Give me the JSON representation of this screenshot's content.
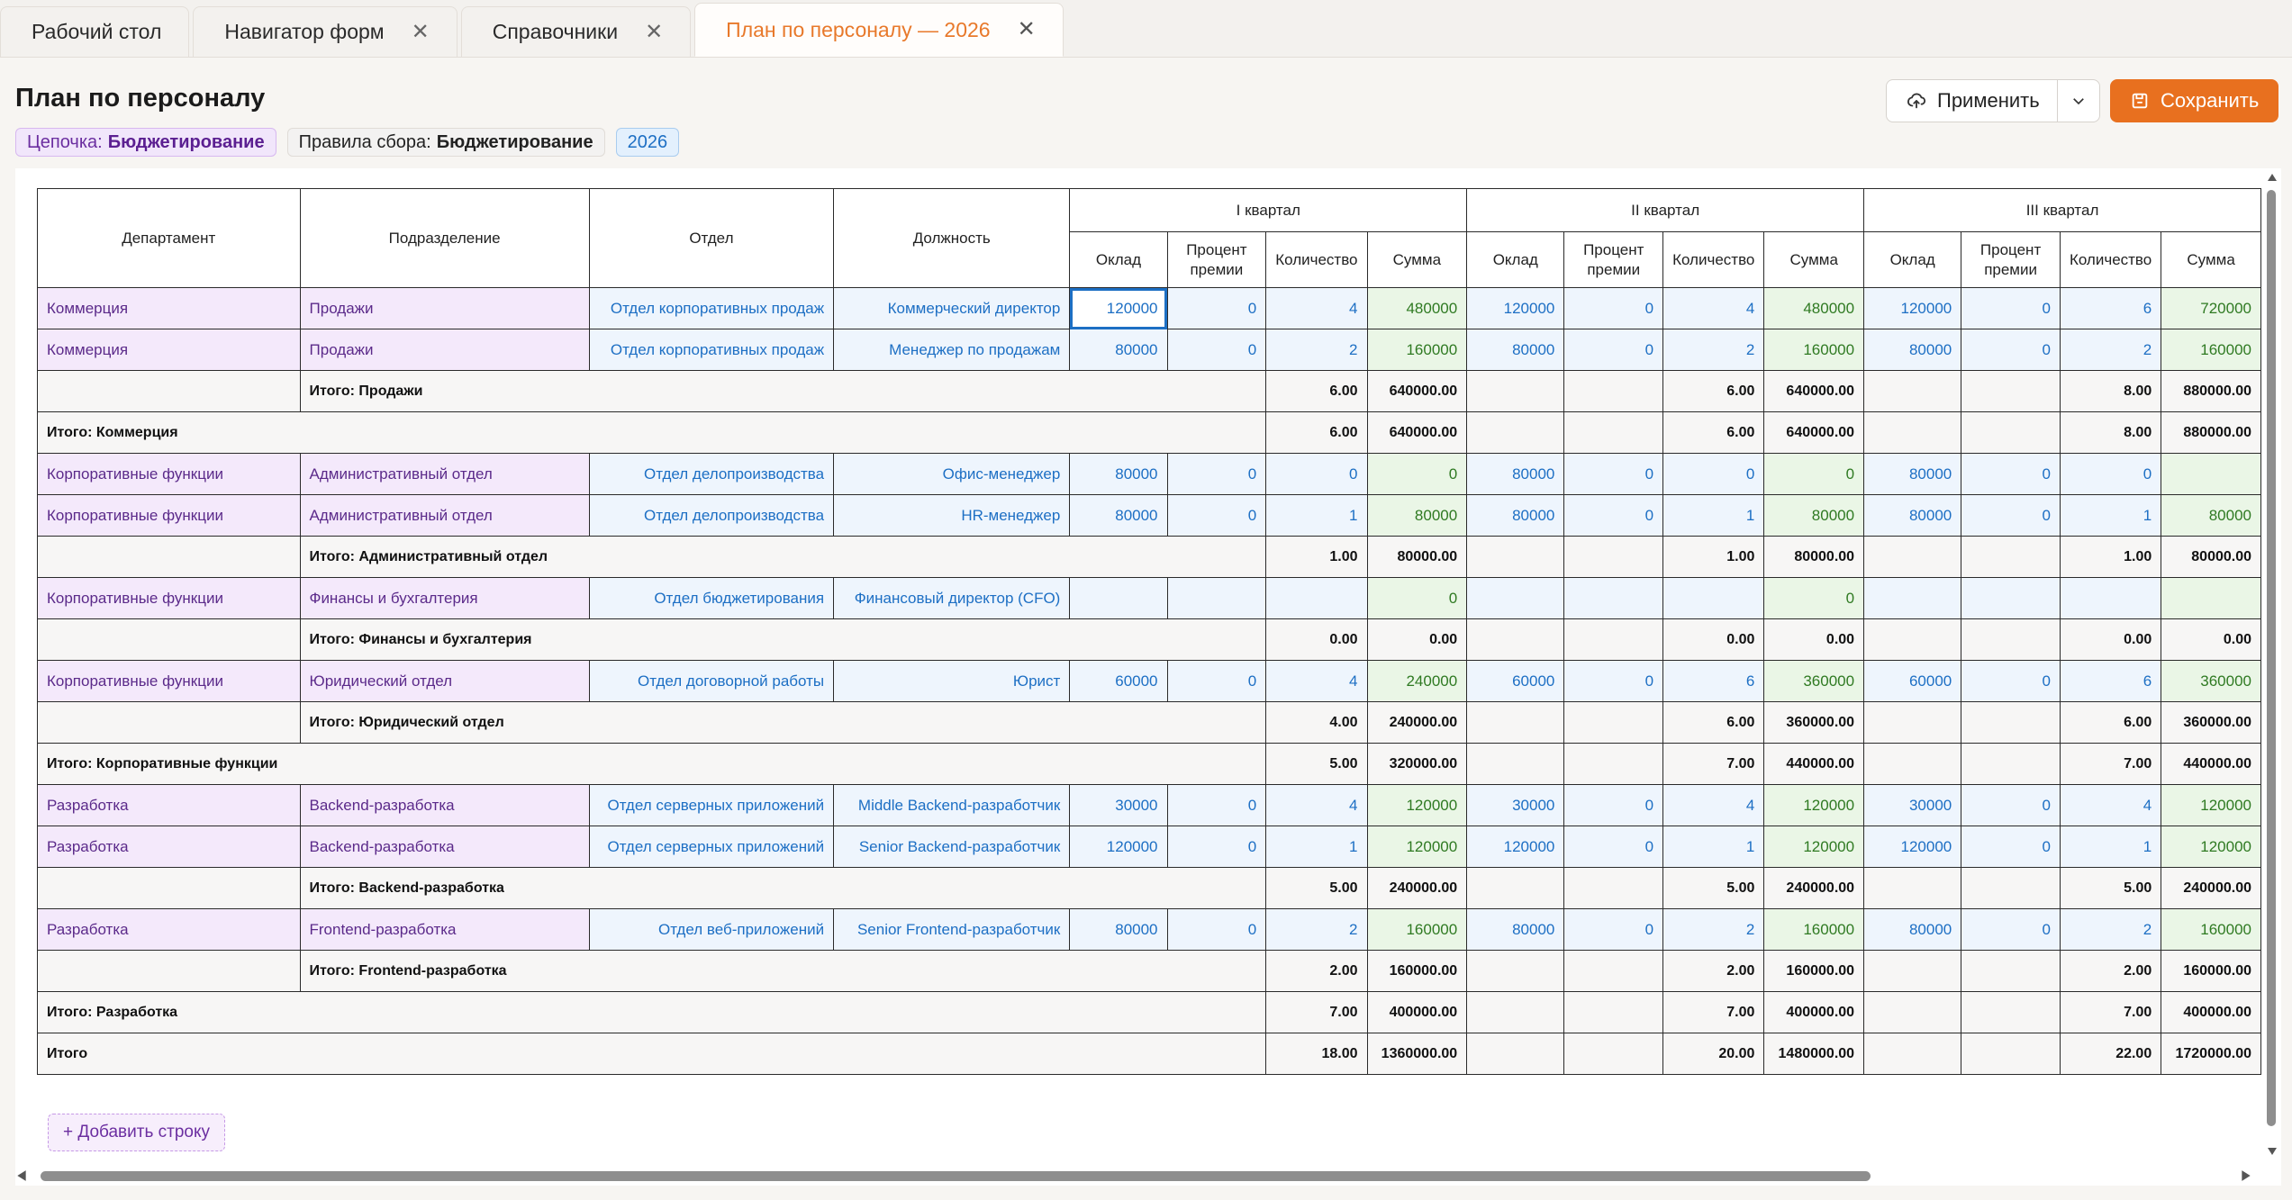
{
  "tabs": [
    {
      "label": "Рабочий стол",
      "closable": false,
      "active": false
    },
    {
      "label": "Навигатор форм",
      "closable": true,
      "active": false
    },
    {
      "label": "Справочники",
      "closable": true,
      "active": false
    },
    {
      "label": "План по персоналу — 2026",
      "closable": true,
      "active": true
    }
  ],
  "header": {
    "title": "План по персоналу",
    "chain_label": "Цепочка:",
    "chain_value": "Бюджетирование",
    "rules_label": "Правила сбора:",
    "rules_value": "Бюджетирование",
    "year": "2026"
  },
  "toolbar": {
    "apply_label": "Применить",
    "save_label": "Сохранить"
  },
  "grid": {
    "columns_fixed": [
      "Департамент",
      "Подразделение",
      "Отдел",
      "Должность"
    ],
    "quarters": [
      "I квартал",
      "II квартал",
      "III квартал"
    ],
    "quarter_columns": [
      "Оклад",
      "Процент премии",
      "Количество",
      "Сумма"
    ],
    "rows": [
      {
        "type": "data",
        "dept": "Коммерция",
        "sub": "Продажи",
        "otd": "Отдел корпоративных продаж",
        "pos": "Коммерческий директор",
        "q": [
          [
            "120000",
            "0",
            "4",
            "480000"
          ],
          [
            "120000",
            "0",
            "4",
            "480000"
          ],
          [
            "120000",
            "0",
            "6",
            "720000"
          ]
        ],
        "selected": true
      },
      {
        "type": "data",
        "dept": "Коммерция",
        "sub": "Продажи",
        "otd": "Отдел корпоративных продаж",
        "pos": "Менеджер по продажам",
        "q": [
          [
            "80000",
            "0",
            "2",
            "160000"
          ],
          [
            "80000",
            "0",
            "2",
            "160000"
          ],
          [
            "80000",
            "0",
            "2",
            "160000"
          ]
        ]
      },
      {
        "type": "subtotal",
        "label": "Итого: Продажи",
        "q": [
          [
            "6.00",
            "640000.00"
          ],
          [
            "6.00",
            "640000.00"
          ],
          [
            "8.00",
            "880000.00"
          ]
        ]
      },
      {
        "type": "total",
        "label": "Итого: Коммерция",
        "q": [
          [
            "6.00",
            "640000.00"
          ],
          [
            "6.00",
            "640000.00"
          ],
          [
            "8.00",
            "880000.00"
          ]
        ]
      },
      {
        "type": "data",
        "dept": "Корпоративные функции",
        "sub": "Административный отдел",
        "otd": "Отдел делопроизводства",
        "pos": "Офис-менеджер",
        "q": [
          [
            "80000",
            "0",
            "0",
            "0"
          ],
          [
            "80000",
            "0",
            "0",
            "0"
          ],
          [
            "80000",
            "0",
            "0",
            ""
          ]
        ]
      },
      {
        "type": "data",
        "dept": "Корпоративные функции",
        "sub": "Административный отдел",
        "otd": "Отдел делопроизводства",
        "pos": "HR-менеджер",
        "q": [
          [
            "80000",
            "0",
            "1",
            "80000"
          ],
          [
            "80000",
            "0",
            "1",
            "80000"
          ],
          [
            "80000",
            "0",
            "1",
            "80000"
          ]
        ]
      },
      {
        "type": "subtotal",
        "label": "Итого: Административный отдел",
        "q": [
          [
            "1.00",
            "80000.00"
          ],
          [
            "1.00",
            "80000.00"
          ],
          [
            "1.00",
            "80000.00"
          ]
        ]
      },
      {
        "type": "data",
        "dept": "Корпоративные функции",
        "sub": "Финансы и бухгалтерия",
        "otd": "Отдел бюджетирования",
        "pos": "Финансовый директор (CFO)",
        "q": [
          [
            "",
            "",
            "",
            "0"
          ],
          [
            "",
            "",
            "",
            "0"
          ],
          [
            "",
            "",
            "",
            ""
          ]
        ]
      },
      {
        "type": "subtotal",
        "label": "Итого: Финансы и бухгалтерия",
        "q": [
          [
            "0.00",
            "0.00"
          ],
          [
            "0.00",
            "0.00"
          ],
          [
            "0.00",
            "0.00"
          ]
        ]
      },
      {
        "type": "data",
        "dept": "Корпоративные функции",
        "sub": "Юридический отдел",
        "otd": "Отдел договорной работы",
        "pos": "Юрист",
        "q": [
          [
            "60000",
            "0",
            "4",
            "240000"
          ],
          [
            "60000",
            "0",
            "6",
            "360000"
          ],
          [
            "60000",
            "0",
            "6",
            "360000"
          ]
        ]
      },
      {
        "type": "subtotal",
        "label": "Итого: Юридический отдел",
        "q": [
          [
            "4.00",
            "240000.00"
          ],
          [
            "6.00",
            "360000.00"
          ],
          [
            "6.00",
            "360000.00"
          ]
        ]
      },
      {
        "type": "total",
        "label": "Итого: Корпоративные функции",
        "q": [
          [
            "5.00",
            "320000.00"
          ],
          [
            "7.00",
            "440000.00"
          ],
          [
            "7.00",
            "440000.00"
          ]
        ]
      },
      {
        "type": "data",
        "dept": "Разработка",
        "sub": "Backend-разработка",
        "otd": "Отдел серверных приложений",
        "pos": "Middle Backend-разработчик",
        "q": [
          [
            "30000",
            "0",
            "4",
            "120000"
          ],
          [
            "30000",
            "0",
            "4",
            "120000"
          ],
          [
            "30000",
            "0",
            "4",
            "120000"
          ]
        ]
      },
      {
        "type": "data",
        "dept": "Разработка",
        "sub": "Backend-разработка",
        "otd": "Отдел серверных приложений",
        "pos": "Senior Backend-разработчик",
        "q": [
          [
            "120000",
            "0",
            "1",
            "120000"
          ],
          [
            "120000",
            "0",
            "1",
            "120000"
          ],
          [
            "120000",
            "0",
            "1",
            "120000"
          ]
        ]
      },
      {
        "type": "subtotal",
        "label": "Итого: Backend-разработка",
        "q": [
          [
            "5.00",
            "240000.00"
          ],
          [
            "5.00",
            "240000.00"
          ],
          [
            "5.00",
            "240000.00"
          ]
        ]
      },
      {
        "type": "data",
        "dept": "Разработка",
        "sub": "Frontend-разработка",
        "otd": "Отдел веб-приложений",
        "pos": "Senior Frontend-разработчик",
        "q": [
          [
            "80000",
            "0",
            "2",
            "160000"
          ],
          [
            "80000",
            "0",
            "2",
            "160000"
          ],
          [
            "80000",
            "0",
            "2",
            "160000"
          ]
        ]
      },
      {
        "type": "subtotal",
        "label": "Итого: Frontend-разработка",
        "q": [
          [
            "2.00",
            "160000.00"
          ],
          [
            "2.00",
            "160000.00"
          ],
          [
            "2.00",
            "160000.00"
          ]
        ]
      },
      {
        "type": "total",
        "label": "Итого: Разработка",
        "q": [
          [
            "7.00",
            "400000.00"
          ],
          [
            "7.00",
            "400000.00"
          ],
          [
            "7.00",
            "400000.00"
          ]
        ]
      },
      {
        "type": "total",
        "label": "Итого",
        "q": [
          [
            "18.00",
            "1360000.00"
          ],
          [
            "20.00",
            "1480000.00"
          ],
          [
            "22.00",
            "1720000.00"
          ]
        ]
      }
    ],
    "add_row_label": "+ Добавить строку"
  },
  "colors": {
    "accent": "#e8701f",
    "link": "#1d6fc4",
    "purple": "#5b2a8a",
    "green_sum": "#2f7a22"
  },
  "icons": {
    "apply": "cloud-upload-icon",
    "save": "save-icon",
    "dropdown": "chevron-down-icon",
    "close": "close-icon"
  }
}
